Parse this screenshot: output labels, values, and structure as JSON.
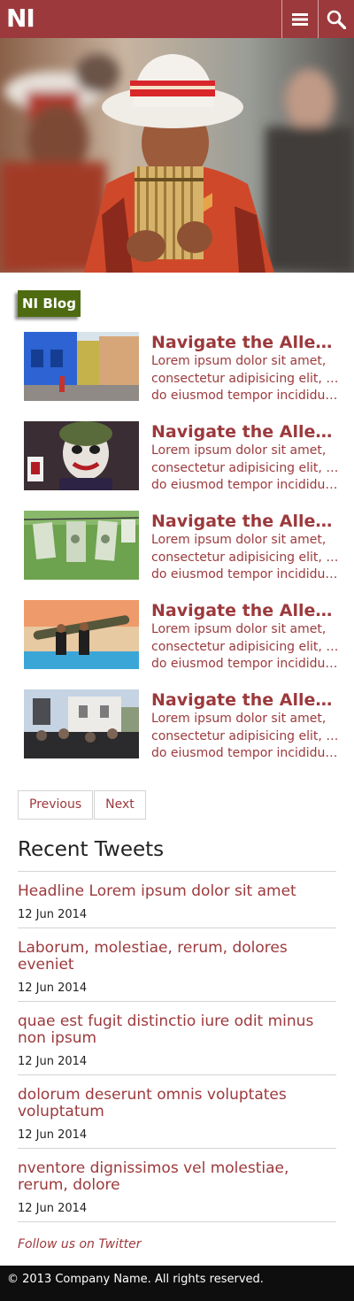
{
  "brand": {
    "logo_text": "NI",
    "accent": "#9c393c",
    "badge_color": "#4e6b11"
  },
  "header": {
    "menu_icon": "hamburger-menu-icon",
    "search_icon": "search-icon"
  },
  "hero": {
    "image": "man-in-white-hat-playing-pan-flute"
  },
  "blog": {
    "badge": "NI Blog",
    "articles": [
      {
        "title": "Navigate the Allegheny River",
        "excerpt_lines": [
          "Lorem ipsum dolor sit amet,",
          "consectetur adipisicing elit, sed",
          "do eiusmod tempor incididunt ut"
        ],
        "thumb": "colorful-street-buildings"
      },
      {
        "title": "Navigate the Allegheny River",
        "excerpt_lines": [
          "Lorem ipsum dolor sit amet,",
          "consectetur adipisicing elit, sed",
          "do eiusmod tempor incididunt ut"
        ],
        "thumb": "joker-holding-card"
      },
      {
        "title": "Navigate the Allegheny River",
        "excerpt_lines": [
          "Lorem ipsum dolor sit amet,",
          "consectetur adipisicing elit, sed",
          "do eiusmod tempor incididunt ut"
        ],
        "thumb": "dollar-bills-on-clothesline"
      },
      {
        "title": "Navigate the Allegheny River",
        "excerpt_lines": [
          "Lorem ipsum dolor sit amet,",
          "consectetur adipisicing elit, sed",
          "do eiusmod tempor incididunt ut"
        ],
        "thumb": "men-carrying-missile"
      },
      {
        "title": "Navigate the Allegheny River",
        "excerpt_lines": [
          "Lorem ipsum dolor sit amet,",
          "consectetur adipisicing elit, sed",
          "do eiusmod tempor incididunt ut"
        ],
        "thumb": "crowd-at-building"
      }
    ]
  },
  "pager": {
    "previous": "Previous",
    "next": "Next"
  },
  "tweets": {
    "title": "Recent Tweets",
    "items": [
      {
        "text": "Headline Lorem ipsum dolor sit amet",
        "date": "12 Jun 2014"
      },
      {
        "text": "Laborum, molestiae, rerum, dolores eveniet",
        "date": "12 Jun 2014"
      },
      {
        "text": "quae est fugit distinctio iure odit minus non ipsum",
        "date": "12 Jun 2014"
      },
      {
        "text": "dolorum deserunt omnis voluptates voluptatum",
        "date": "12 Jun 2014"
      },
      {
        "text": "nventore dignissimos vel molestiae, rerum, dolore",
        "date": "12 Jun 2014"
      }
    ],
    "follow": "Follow us on Twitter"
  },
  "footer": {
    "copyright": "© 2013 Company Name. All rights reserved."
  }
}
